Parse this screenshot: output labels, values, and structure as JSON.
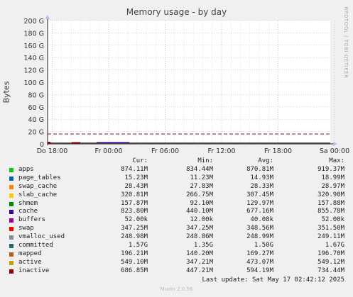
{
  "title": "Memory usage - by day",
  "side_text": "RRDTOOL / TOBI OETIKER",
  "chart_data": {
    "type": "area",
    "title": "Memory usage - by day",
    "ylabel": "Bytes",
    "ylim": [
      0,
      200
    ],
    "y_unit": "G",
    "y_ticks": [
      "0",
      "20 G",
      "40 G",
      "60 G",
      "80 G",
      "100 G",
      "120 G",
      "140 G",
      "160 G",
      "180 G",
      "200 G"
    ],
    "x_ticks": [
      "Do 18:00",
      "Fr 00:00",
      "Fr 06:00",
      "Fr 12:00",
      "Fr 18:00",
      "Sa 00:00"
    ],
    "grid": true,
    "limit_line_value": 16.1
  },
  "legend": {
    "headers": [
      "Cur:",
      "Min:",
      "Avg:",
      "Max:"
    ],
    "rows": [
      {
        "name": "apps",
        "color": "#00cc00",
        "cur": "874.11M",
        "min": "834.44M",
        "avg": "870.81M",
        "max": "919.37M"
      },
      {
        "name": "page_tables",
        "color": "#0066b3",
        "cur": "15.23M",
        "min": "11.23M",
        "avg": "14.93M",
        "max": "18.99M"
      },
      {
        "name": "swap_cache",
        "color": "#ff8000",
        "cur": "28.43M",
        "min": "27.83M",
        "avg": "28.33M",
        "max": "28.97M"
      },
      {
        "name": "slab_cache",
        "color": "#ffcc00",
        "cur": "320.81M",
        "min": "266.75M",
        "avg": "307.45M",
        "max": "320.90M"
      },
      {
        "name": "shmem",
        "color": "#008f00",
        "cur": "157.87M",
        "min": "92.10M",
        "avg": "129.97M",
        "max": "157.88M"
      },
      {
        "name": "cache",
        "color": "#330099",
        "cur": "823.80M",
        "min": "440.10M",
        "avg": "677.16M",
        "max": "855.78M"
      },
      {
        "name": "buffers",
        "color": "#990099",
        "cur": "52.00k",
        "min": "12.00k",
        "avg": "40.08k",
        "max": "52.00k"
      },
      {
        "name": "swap",
        "color": "#ff0000",
        "cur": "347.25M",
        "min": "347.25M",
        "avg": "348.56M",
        "max": "351.50M"
      },
      {
        "name": "vmalloc_used",
        "color": "#8a8a8a",
        "cur": "248.98M",
        "min": "248.86M",
        "avg": "248.99M",
        "max": "249.11M"
      },
      {
        "name": "committed",
        "color": "#24696f",
        "cur": "1.57G",
        "min": "1.35G",
        "avg": "1.50G",
        "max": "1.67G"
      },
      {
        "name": "mapped",
        "color": "#b85c1a",
        "cur": "196.21M",
        "min": "140.20M",
        "avg": "169.27M",
        "max": "196.70M"
      },
      {
        "name": "active",
        "color": "#c3a200",
        "cur": "549.10M",
        "min": "347.21M",
        "avg": "473.07M",
        "max": "549.12M"
      },
      {
        "name": "inactive",
        "color": "#990000",
        "cur": "686.85M",
        "min": "447.21M",
        "avg": "594.19M",
        "max": "734.44M"
      }
    ]
  },
  "last_update": "Last update: Sat May 17 02:42:12 2025",
  "footer": "Munin 2.0.56"
}
